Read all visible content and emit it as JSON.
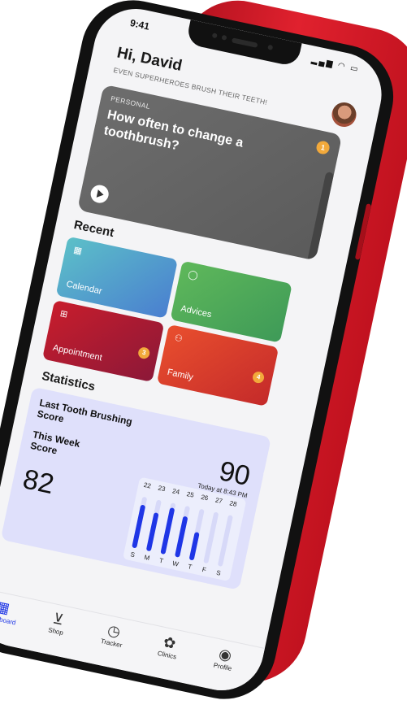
{
  "status": {
    "time": "9:41"
  },
  "header": {
    "greeting": "Hi, David",
    "tagline": "EVEN SUPERHEROES BRUSH THEIR TEETH!"
  },
  "hero": {
    "kicker": "PERSONAL",
    "title": "How often to change a toothbrush?",
    "badge": "1"
  },
  "recent": {
    "title": "Recent",
    "tiles": [
      {
        "label": "Calendar",
        "icon": "calendar-icon",
        "color": "#5bb9c8"
      },
      {
        "label": "Advices",
        "icon": "chat-bubble-icon",
        "color": "#4fae55"
      },
      {
        "label": "Appointment",
        "icon": "plus-square-icon",
        "color": "#cf2532",
        "badge": "3"
      },
      {
        "label": "Family",
        "icon": "people-icon",
        "color": "#e6462f",
        "badge": "4"
      }
    ]
  },
  "statistics": {
    "title": "Statistics",
    "last_brushing": {
      "title": "Last Tooth Brushing Score",
      "score": "90",
      "when": "Today at 8:43 PM"
    },
    "this_week": {
      "title": "This Week Score",
      "score": "82",
      "days": [
        {
          "date": "22",
          "dow": "S",
          "level": 0.85
        },
        {
          "date": "23",
          "dow": "M",
          "level": 0.75
        },
        {
          "date": "24",
          "dow": "T",
          "level": 0.9
        },
        {
          "date": "25",
          "dow": "W",
          "level": 0.8
        },
        {
          "date": "26",
          "dow": "T",
          "level": 0.55
        },
        {
          "date": "27",
          "dow": "F",
          "level": 0
        },
        {
          "date": "28",
          "dow": "S",
          "level": 0
        }
      ]
    }
  },
  "tabbar": {
    "tabs": [
      {
        "label": "Dashboard",
        "icon": "grid-icon",
        "active": true
      },
      {
        "label": "Shop",
        "icon": "cart-icon",
        "active": false
      },
      {
        "label": "Tracker",
        "icon": "timer-icon",
        "active": false
      },
      {
        "label": "Clinics",
        "icon": "tooth-icon",
        "active": false
      },
      {
        "label": "Profile",
        "icon": "user-icon",
        "active": false
      }
    ]
  },
  "colors": {
    "phone_red": "#d81d2b",
    "accent_blue": "#1f36e6",
    "badge_orange": "#f2a93b",
    "stats_bg": "#dfe0fb"
  }
}
